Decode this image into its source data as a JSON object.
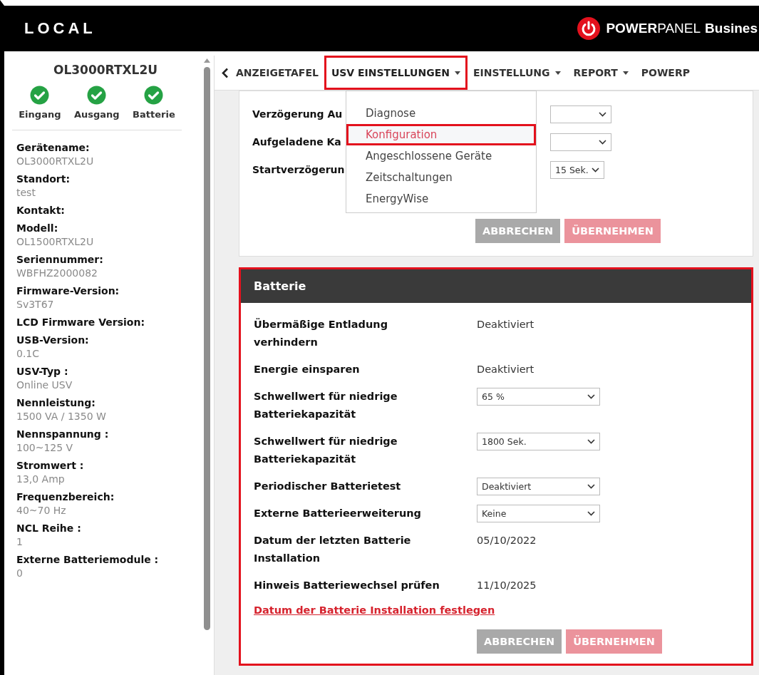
{
  "header": {
    "title": "LOCAL",
    "brand": [
      {
        "text": "POWER",
        "bold": true
      },
      {
        "text": "PANEL",
        "bold": false
      },
      {
        "text": "Busines",
        "bold": true
      }
    ]
  },
  "sidebar": {
    "device": "OL3000RTXL2U",
    "status": [
      {
        "label": "Eingang",
        "ok": true
      },
      {
        "label": "Ausgang",
        "ok": true
      },
      {
        "label": "Batterie",
        "ok": true
      }
    ],
    "fields": [
      {
        "label": "Gerätename:",
        "value": "OL3000RTXL2U"
      },
      {
        "label": "Standort:",
        "value": "test"
      },
      {
        "label": "Kontakt:"
      },
      {
        "label": "Modell:",
        "value": "OL1500RTXL2U"
      },
      {
        "label": "Seriennummer:",
        "value": "WBFHZ2000082"
      },
      {
        "label": "Firmware-Version:",
        "value": "Sv3T67"
      },
      {
        "label": "LCD Firmware Version:"
      },
      {
        "label": "USB-Version:",
        "value": "0.1C"
      },
      {
        "label": "USV-Typ :",
        "value": "Online USV"
      },
      {
        "label": "Nennleistung:",
        "value": "1500 VA / 1350 W"
      },
      {
        "label": "Nennspannung :",
        "value": "100~125 V"
      },
      {
        "label": "Stromwert :",
        "value": "13,0 Amp"
      },
      {
        "label": "Frequenzbereich:",
        "value": "40~70 Hz"
      },
      {
        "label": "NCL Reihe :",
        "value": "1"
      },
      {
        "label": "Externe Batteriemodule :",
        "value": "0"
      }
    ]
  },
  "nav": {
    "items": [
      {
        "label": "ANZEIGETAFEL",
        "dropdown": false,
        "selected": false,
        "highlighted": false
      },
      {
        "label": "USV EINSTELLUNGEN",
        "dropdown": true,
        "selected": true,
        "highlighted": true
      },
      {
        "label": "EINSTELLUNG",
        "dropdown": true,
        "selected": false,
        "highlighted": false
      },
      {
        "label": "REPORT",
        "dropdown": true,
        "selected": false,
        "highlighted": false
      },
      {
        "label": "POWERP",
        "dropdown": false,
        "selected": false,
        "highlighted": false
      }
    ]
  },
  "menu": {
    "items": [
      {
        "label": "Diagnose",
        "selected": false,
        "highlighted": false
      },
      {
        "label": "Konfiguration",
        "selected": true,
        "highlighted": true
      },
      {
        "label": "Angeschlossene Geräte",
        "selected": false,
        "highlighted": false
      },
      {
        "label": "Zeitschaltungen",
        "selected": false,
        "highlighted": false
      },
      {
        "label": "EnergyWise",
        "selected": false,
        "highlighted": false
      }
    ]
  },
  "top_card": {
    "rows": [
      {
        "label": "Verzögerung Au"
      },
      {
        "label": "Aufgeladene Ka"
      },
      {
        "label": "Startverzögerun",
        "value": "15 Sek."
      }
    ],
    "buttons": [
      {
        "label": "ABBRECHEN",
        "kind": "cancel",
        "disabled": true
      },
      {
        "label": "ÜBERNEHMEN",
        "kind": "apply",
        "disabled": true
      }
    ]
  },
  "battery_card": {
    "title": "Batterie",
    "highlighted": true,
    "rows": [
      {
        "kind": "text",
        "label": "Übermäßige Entladung verhindern",
        "value": "Deaktiviert"
      },
      {
        "kind": "text",
        "label": "Energie einsparen",
        "value": "Deaktiviert"
      },
      {
        "kind": "select",
        "label": "Schwellwert für niedrige Batteriekapazität",
        "value": "65 %"
      },
      {
        "kind": "select",
        "label": "Schwellwert für niedrige Batteriekapazität",
        "value": "1800 Sek."
      },
      {
        "kind": "select",
        "label": "Periodischer Batterietest",
        "value": "Deaktiviert"
      },
      {
        "kind": "select",
        "label": "Externe Batterieerweiterung",
        "value": "Keine"
      },
      {
        "kind": "text",
        "label": "Datum der letzten Batterie Installation",
        "value": "05/10/2022"
      },
      {
        "kind": "text",
        "label": "Hinweis Batteriewechsel prüfen",
        "value": "11/10/2025"
      }
    ],
    "link": "Datum der Batterie Installation festlegen",
    "buttons": [
      {
        "label": "ABBRECHEN",
        "kind": "cancel",
        "disabled": true
      },
      {
        "label": "ÜBERNEHMEN",
        "kind": "apply",
        "disabled": true
      }
    ]
  }
}
